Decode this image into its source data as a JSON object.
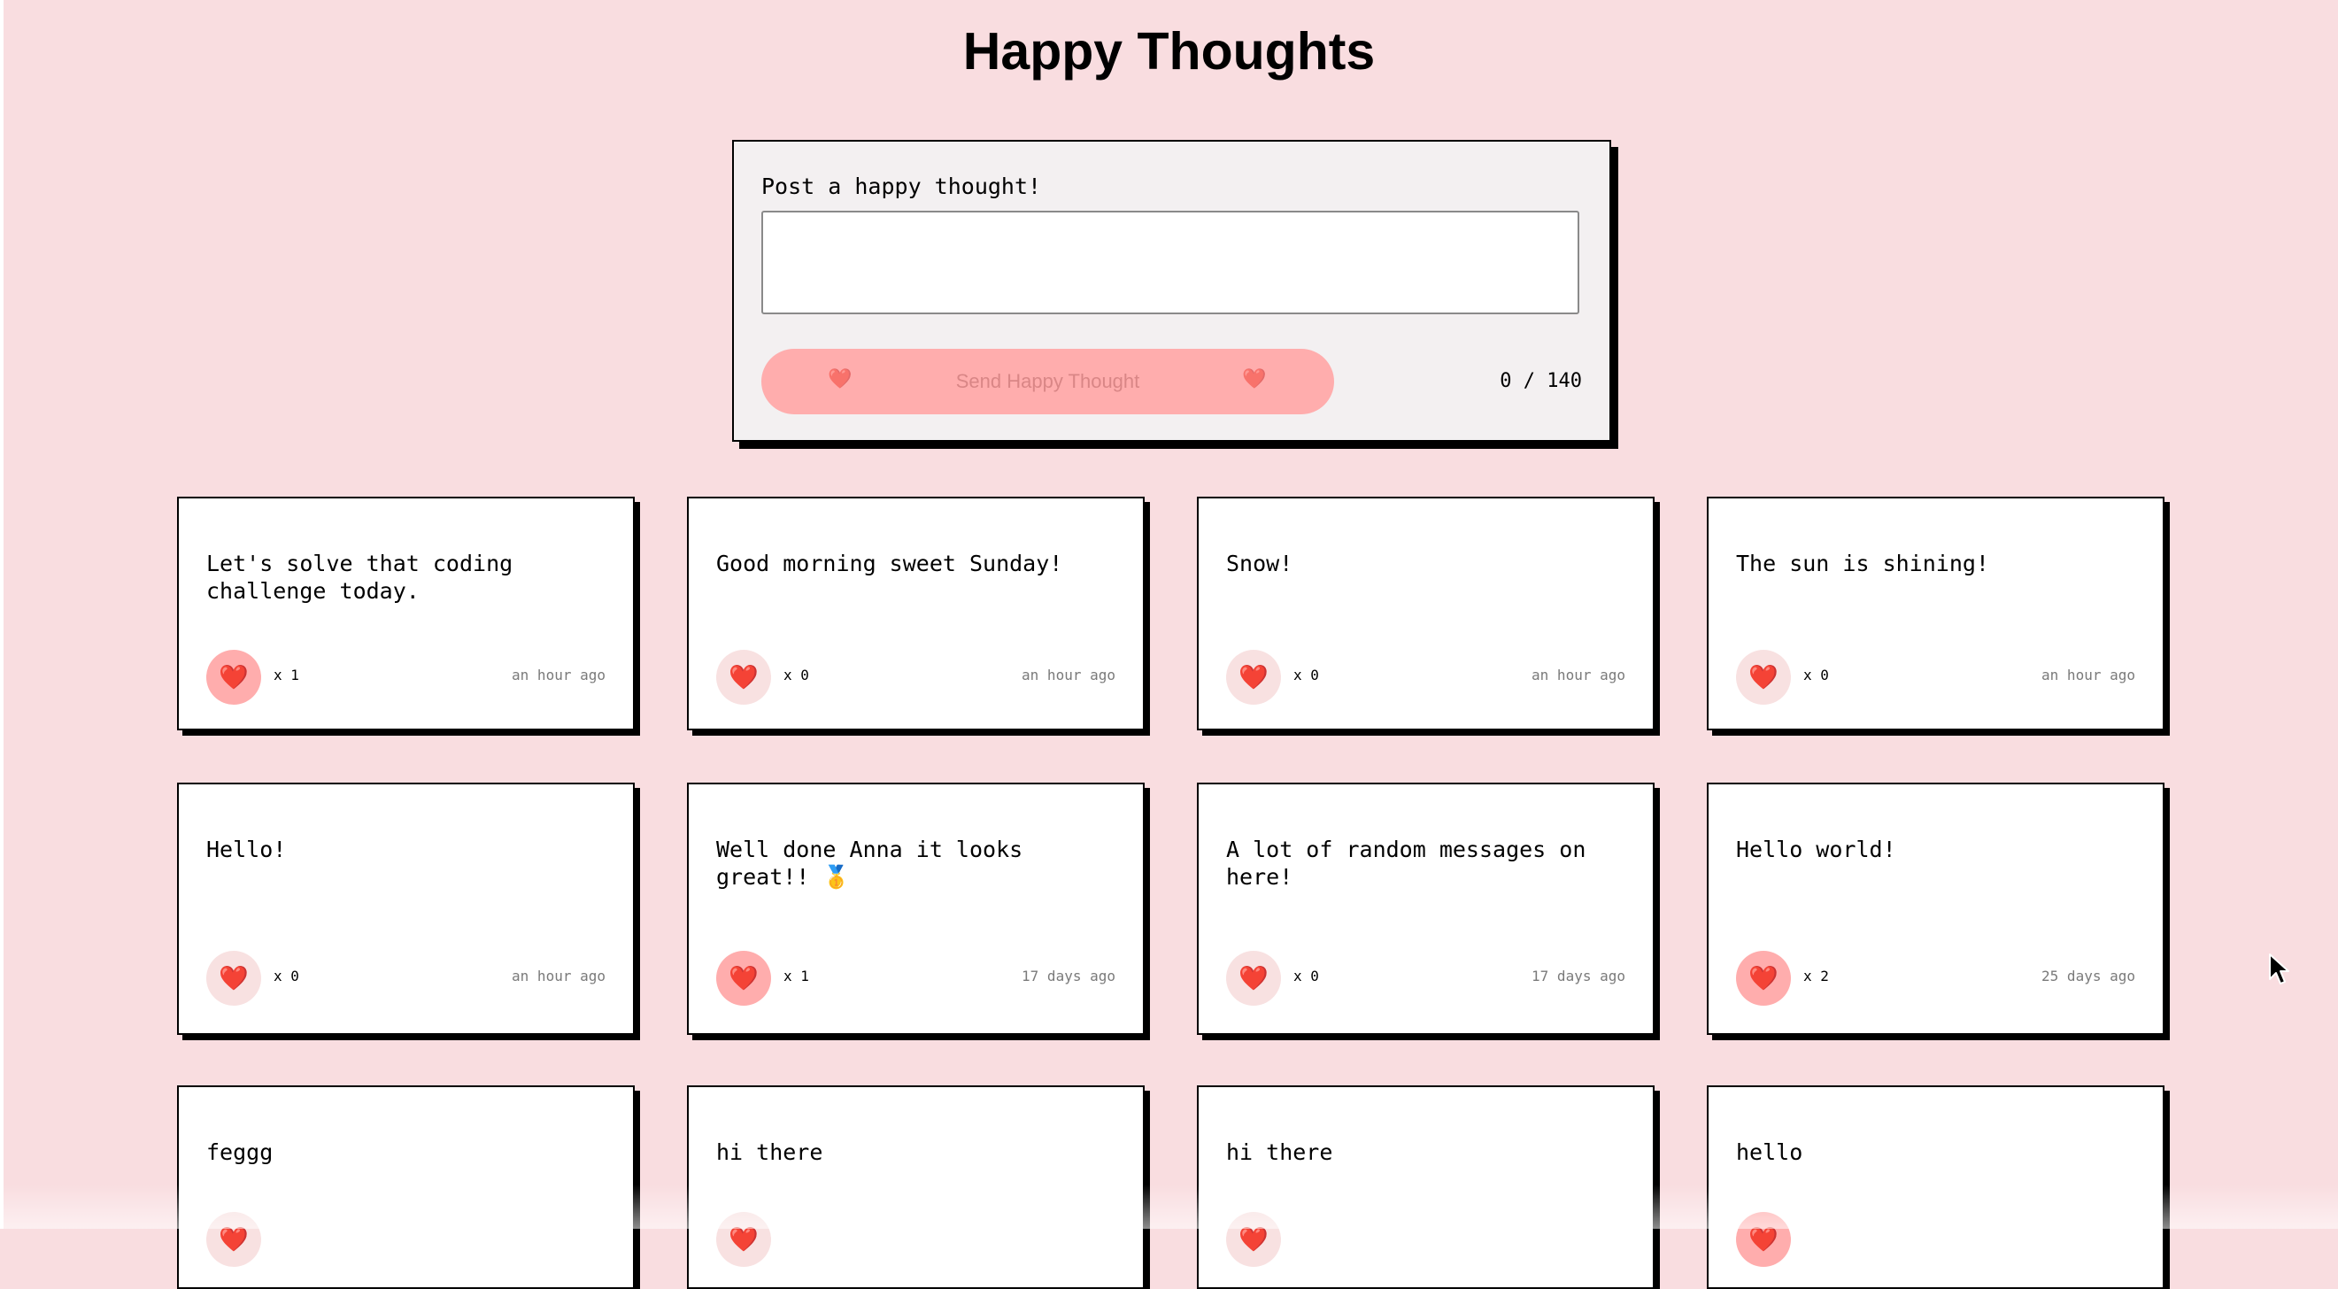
{
  "header": {
    "title": "Happy Thoughts"
  },
  "form": {
    "label": "Post a happy thought!",
    "input_value": "",
    "input_placeholder": "",
    "send_label": "Send Happy Thought",
    "heart_glyph": "❤️",
    "char_count": "0 / 140"
  },
  "icons": {
    "like": "heart-icon",
    "cursor": "mouse-pointer-icon"
  },
  "colors": {
    "background": "#f9dde0",
    "button": "#ffadad",
    "liked": "#ffadad",
    "unliked": "#f8e1e1",
    "heart": "#e0102d"
  },
  "thoughts": [
    {
      "message": "Let's solve that coding challenge today.",
      "likes_text": "x 1",
      "liked": true,
      "time": "an hour ago"
    },
    {
      "message": "Good morning sweet Sunday!",
      "likes_text": "x 0",
      "liked": false,
      "time": "an hour ago"
    },
    {
      "message": "Snow!",
      "likes_text": "x 0",
      "liked": false,
      "time": "an hour ago"
    },
    {
      "message": "The sun is shining!",
      "likes_text": "x 0",
      "liked": false,
      "time": "an hour ago"
    },
    {
      "message": "Hello!",
      "likes_text": "x 0",
      "liked": false,
      "time": "an hour ago"
    },
    {
      "message": "Well done Anna it looks great!! 🥇",
      "likes_text": "x 1",
      "liked": true,
      "time": "17 days ago"
    },
    {
      "message": "A lot of random messages on here!",
      "likes_text": "x 0",
      "liked": false,
      "time": "17 days ago"
    },
    {
      "message": "Hello world!",
      "likes_text": "x 2",
      "liked": true,
      "time": "25 days ago"
    },
    {
      "message": "feggg",
      "likes_text": "",
      "liked": false,
      "time": ""
    },
    {
      "message": "hi there",
      "likes_text": "",
      "liked": false,
      "time": ""
    },
    {
      "message": "hi there",
      "likes_text": "",
      "liked": false,
      "time": ""
    },
    {
      "message": "hello",
      "likes_text": "",
      "liked": true,
      "time": ""
    }
  ]
}
